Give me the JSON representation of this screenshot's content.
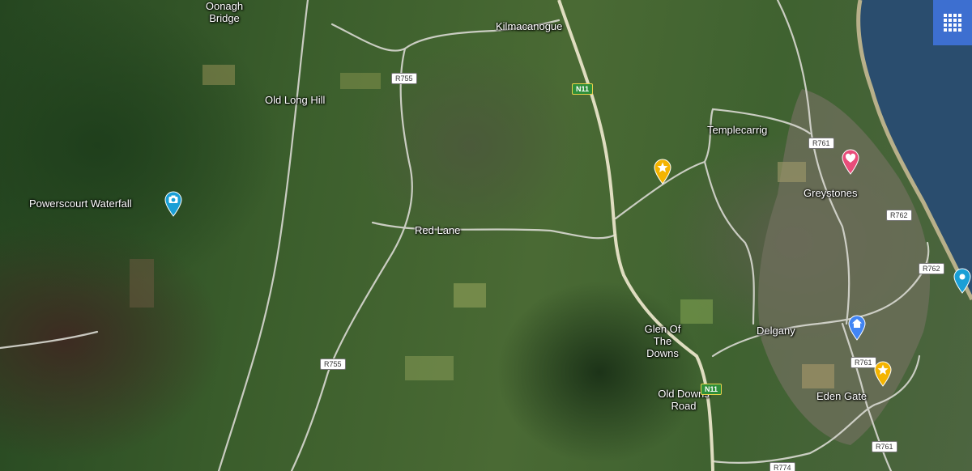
{
  "map": {
    "type": "satellite",
    "places": [
      {
        "id": "oonagh-bridge",
        "text": "Oonagh\nBridge"
      },
      {
        "id": "kilmacanogue",
        "text": "Kilmacanogue"
      },
      {
        "id": "old-long-hill",
        "text": "Old Long Hill"
      },
      {
        "id": "templecarrig",
        "text": "Templecarrig"
      },
      {
        "id": "powerscourt-waterfall",
        "text": "Powerscourt Waterfall"
      },
      {
        "id": "greystones",
        "text": "Greystones"
      },
      {
        "id": "red-lane",
        "text": "Red Lane"
      },
      {
        "id": "glen-of-the-downs",
        "text": "Glen Of\nThe Downs"
      },
      {
        "id": "delgany",
        "text": "Delgany"
      },
      {
        "id": "old-downs-road",
        "text": "Old Downs\nRoad"
      },
      {
        "id": "eden-gate",
        "text": "Eden Gate"
      }
    ],
    "roads": {
      "r755_a": "R755",
      "r755_b": "R755",
      "n11_a": "N11",
      "n11_b": "N11",
      "r761_a": "R761",
      "r761_b": "R761",
      "r761_c": "R761",
      "r762_a": "R762",
      "r762_b": "R762",
      "r774": "R774"
    },
    "markers": [
      {
        "id": "powerscourt-camera",
        "icon": "camera-icon",
        "color": "#1a9fd6"
      },
      {
        "id": "star-templecarrig",
        "icon": "star-icon",
        "color": "#f4b400"
      },
      {
        "id": "heart-greystones",
        "icon": "heart-icon",
        "color": "#e84d7a"
      },
      {
        "id": "pin-coast",
        "icon": "location-icon",
        "color": "#1a9fd6"
      },
      {
        "id": "home-delgany",
        "icon": "home-icon",
        "color": "#4285f4"
      },
      {
        "id": "star-eden-gate",
        "icon": "star-icon",
        "color": "#f4b400"
      }
    ],
    "apps_button": {
      "icon": "grid-icon",
      "color": "#3d6fd0"
    }
  }
}
